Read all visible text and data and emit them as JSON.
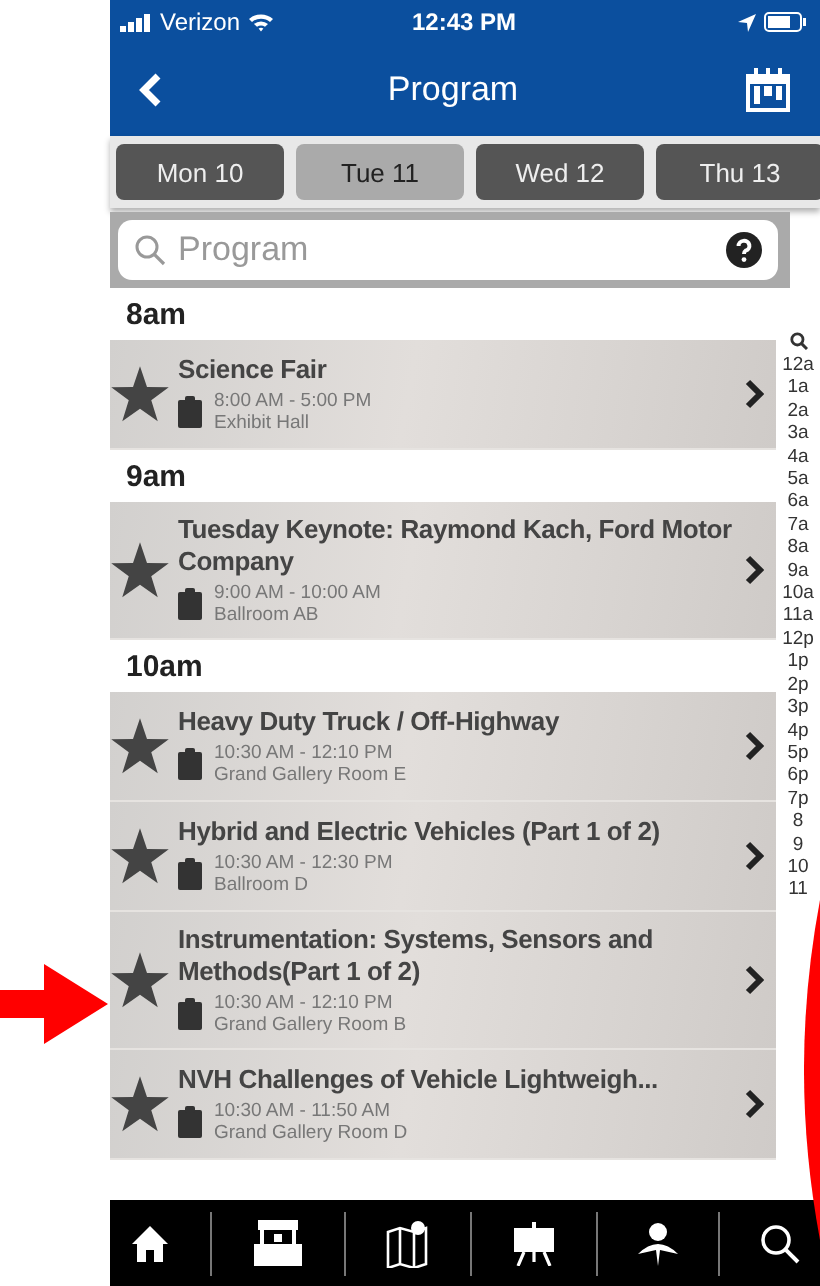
{
  "status_bar": {
    "carrier": "Verizon",
    "time": "12:43 PM"
  },
  "nav": {
    "title": "Program"
  },
  "days": [
    {
      "label": "Mon 10",
      "selected": false
    },
    {
      "label": "Tue 11",
      "selected": true
    },
    {
      "label": "Wed 12",
      "selected": false
    },
    {
      "label": "Thu 13",
      "selected": false
    }
  ],
  "search": {
    "placeholder": "Program"
  },
  "sections": [
    {
      "time": "8am",
      "events": [
        {
          "title": "Science Fair",
          "time": "8:00 AM - 5:00 PM",
          "room": "Exhibit Hall"
        }
      ]
    },
    {
      "time": "9am",
      "events": [
        {
          "title": "Tuesday Keynote: Raymond Kach, Ford Motor Company",
          "time": "9:00 AM - 10:00 AM",
          "room": "Ballroom AB"
        }
      ]
    },
    {
      "time": "10am",
      "events": [
        {
          "title": "Heavy Duty Truck / Off-Highway",
          "time": "10:30 AM - 12:10 PM",
          "room": "Grand Gallery Room E"
        },
        {
          "title": "Hybrid and Electric Vehicles (Part 1 of 2)",
          "time": "10:30 AM - 12:30 PM",
          "room": "Ballroom D"
        },
        {
          "title": "Instrumentation: Systems, Sensors and Methods(Part 1 of 2)",
          "time": "10:30 AM - 12:10 PM",
          "room": "Grand Gallery Room B"
        },
        {
          "title": "NVH Challenges of Vehicle Lightweigh...",
          "time": "10:30 AM - 11:50 AM",
          "room": "Grand Gallery Room D"
        }
      ]
    }
  ],
  "index": [
    "12a",
    "1a",
    "2a",
    "3a",
    "4a",
    "5a",
    "6a",
    "7a",
    "8a",
    "9a",
    "10a",
    "11a",
    "12p",
    "1p",
    "2p",
    "3p",
    "4p",
    "5p",
    "6p",
    "7p",
    "8",
    "9",
    "10",
    "11"
  ]
}
